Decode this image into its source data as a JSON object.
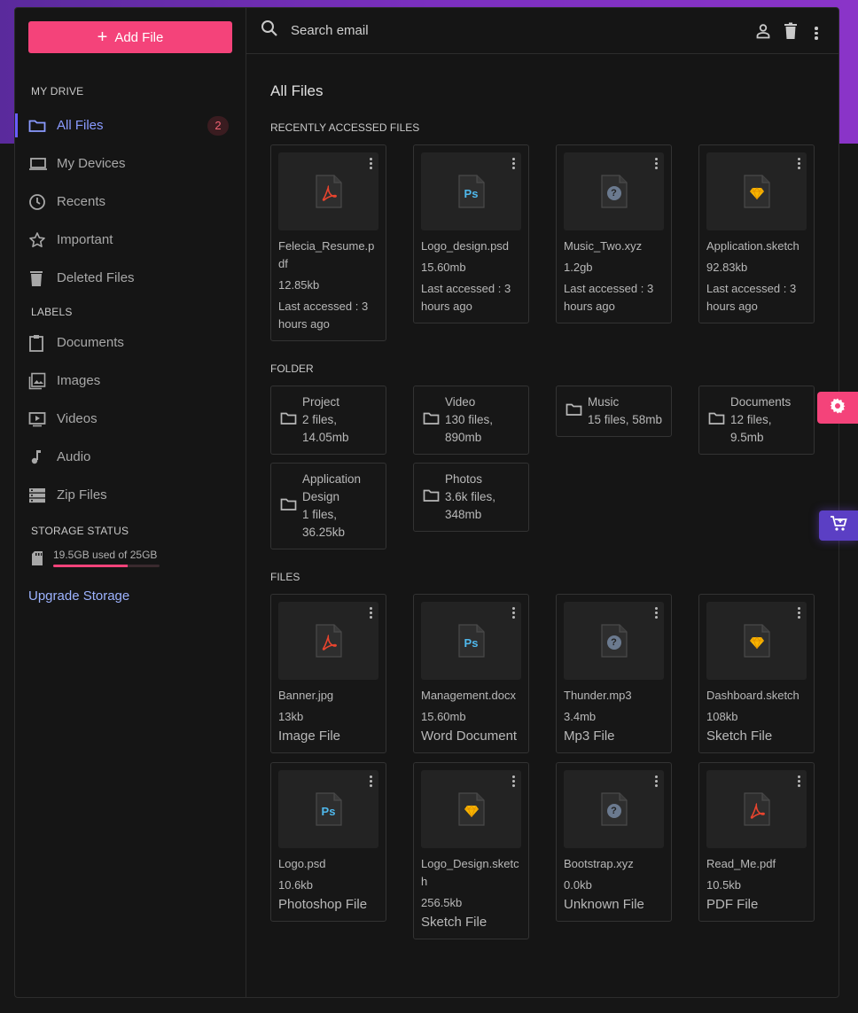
{
  "sidebar": {
    "add_label": "Add File",
    "my_drive_title": "MY DRIVE",
    "drive_items": [
      {
        "label": "All Files",
        "badge": "2"
      },
      {
        "label": "My Devices"
      },
      {
        "label": "Recents"
      },
      {
        "label": "Important"
      },
      {
        "label": "Deleted Files"
      }
    ],
    "labels_title": "LABELS",
    "label_items": [
      {
        "label": "Documents"
      },
      {
        "label": "Images"
      },
      {
        "label": "Videos"
      },
      {
        "label": "Audio"
      },
      {
        "label": "Zip Files"
      }
    ],
    "storage_title": "STORAGE STATUS",
    "storage_text": "19.5GB used of 25GB",
    "storage_used_fraction": 0.7,
    "upgrade_label": "Upgrade Storage"
  },
  "search": {
    "placeholder": "Search email"
  },
  "main": {
    "title": "All Files",
    "recent_title": "RECENTLY ACCESSED FILES",
    "recent": [
      {
        "name": "Felecia_Resume.pdf",
        "size": "12.85kb",
        "meta": "Last accessed : 3 hours ago",
        "icon": "pdf"
      },
      {
        "name": "Logo_design.psd",
        "size": "15.60mb",
        "meta": "Last accessed : 3 hours ago",
        "icon": "psd"
      },
      {
        "name": "Music_Two.xyz",
        "size": "1.2gb",
        "meta": "Last accessed : 3 hours ago",
        "icon": "unknown"
      },
      {
        "name": "Application.sketch",
        "size": "92.83kb",
        "meta": "Last accessed : 3 hours ago",
        "icon": "sketch"
      }
    ],
    "folder_title": "FOLDER",
    "folders": [
      {
        "name": "Project",
        "meta": "2 files, 14.05mb"
      },
      {
        "name": "Video",
        "meta": "130 files, 890mb"
      },
      {
        "name": "Music",
        "meta": "15 files, 58mb"
      },
      {
        "name": "Documents",
        "meta": "12 files, 9.5mb"
      },
      {
        "name": "Application Design",
        "meta": "1 files, 36.25kb"
      },
      {
        "name": "Photos",
        "meta": "3.6k files, 348mb"
      }
    ],
    "files_title": "FILES",
    "files": [
      {
        "name": "Banner.jpg",
        "size": "13kb",
        "type": "Image File",
        "icon": "pdf"
      },
      {
        "name": "Management.docx",
        "size": "15.60mb",
        "type": "Word Document",
        "icon": "psd"
      },
      {
        "name": "Thunder.mp3",
        "size": "3.4mb",
        "type": "Mp3 File",
        "icon": "unknown"
      },
      {
        "name": "Dashboard.sketch",
        "size": "108kb",
        "type": "Sketch File",
        "icon": "sketch"
      },
      {
        "name": "Logo.psd",
        "size": "10.6kb",
        "type": "Photoshop File",
        "icon": "psd"
      },
      {
        "name": "Logo_Design.sketch",
        "size": "256.5kb",
        "type": "Sketch File",
        "icon": "sketch"
      },
      {
        "name": "Bootstrap.xyz",
        "size": "0.0kb",
        "type": "Unknown File",
        "icon": "unknown"
      },
      {
        "name": "Read_Me.pdf",
        "size": "10.5kb",
        "type": "PDF File",
        "icon": "pdf"
      }
    ]
  },
  "colors": {
    "accent": "#f4437a",
    "active": "#8a9bff",
    "settings": "#f4437a",
    "cart": "#5b3fc4"
  }
}
